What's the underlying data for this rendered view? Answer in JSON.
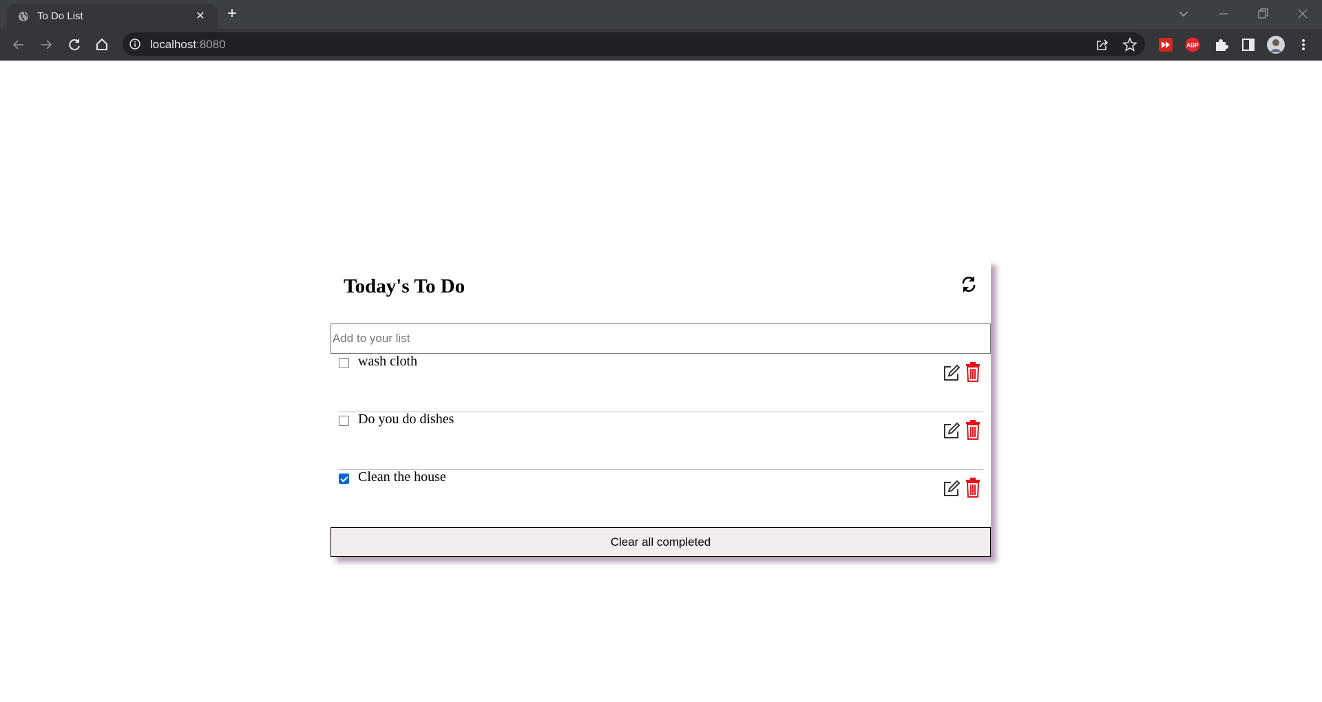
{
  "browser": {
    "tab_title": "To Do List",
    "new_tab_symbol": "+",
    "close_symbol": "✕",
    "url_host": "localhost",
    "url_port": ":8080"
  },
  "app": {
    "title": "Today's To Do",
    "input_placeholder": "Add to your list",
    "items": [
      {
        "text": "wash cloth",
        "completed": false
      },
      {
        "text": "Do you do dishes",
        "completed": false
      },
      {
        "text": "Clean the house",
        "completed": true
      }
    ],
    "clear_label": "Clear all completed",
    "colors": {
      "delete": "#e3131b",
      "card_shadow": "#7e5e80",
      "clear_bg": "#f4eded",
      "checkbox_checked": "#0b65d8"
    }
  }
}
